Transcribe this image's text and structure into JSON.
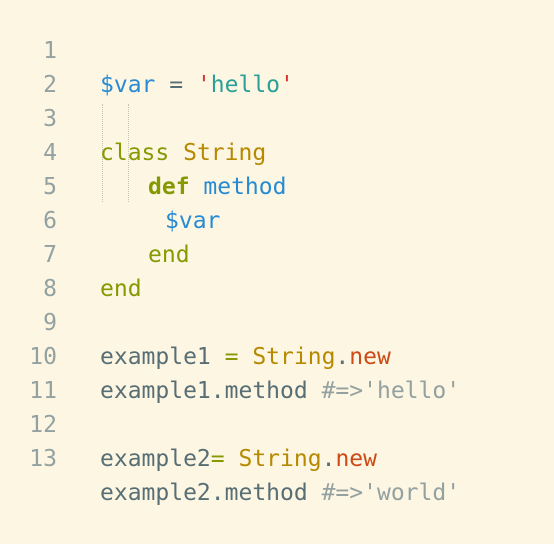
{
  "gutter": {
    "line_numbers": [
      "1",
      "2",
      "3",
      "4",
      "5",
      "6",
      "7",
      "8",
      "9",
      "10",
      "11",
      "12",
      "13"
    ]
  },
  "code": {
    "l1": {
      "var": "$var",
      "assign": " = ",
      "quote_open": "'",
      "text": "hello",
      "quote_close": "'"
    },
    "l3": {
      "kw": "class",
      "name": " String"
    },
    "l4": {
      "kw": "def",
      "name": " method"
    },
    "l5": {
      "var": "$var"
    },
    "l6": {
      "kw": "end"
    },
    "l7": {
      "kw": "end"
    },
    "l9": {
      "id": "example1",
      "assign": " = ",
      "cls": "String",
      "dot": ".",
      "new": "new"
    },
    "l10": {
      "recv": "example1",
      "dot": ".",
      "meth": "method",
      "comment": " #=>'hello'"
    },
    "l12": {
      "id": "example2",
      "assign": "= ",
      "cls": "String",
      "dot": ".",
      "new": "new"
    },
    "l13": {
      "recv": "example2",
      "dot": ".",
      "meth": "method",
      "comment": " #=>'world'"
    }
  }
}
